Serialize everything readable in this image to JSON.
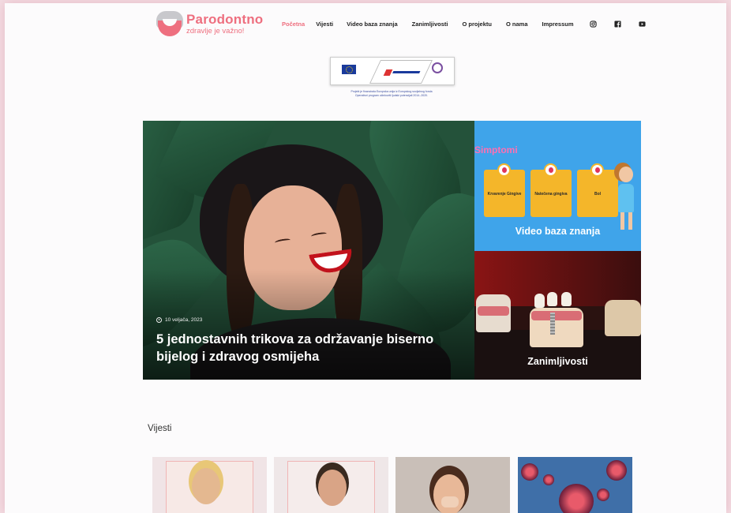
{
  "site": {
    "logo_name": "Parodontno",
    "logo_tagline": "zdravlje je važno!"
  },
  "nav": {
    "items": [
      {
        "label": "Početna",
        "active": true
      },
      {
        "label": "Vijesti"
      },
      {
        "label": "Video baza znanja"
      },
      {
        "label": "Zanimljivosti"
      },
      {
        "label": "O projektu"
      },
      {
        "label": "O nama"
      },
      {
        "label": "Impressum"
      }
    ],
    "social_icons": [
      "instagram-icon",
      "facebook-icon",
      "youtube-icon"
    ]
  },
  "eu_banner": {
    "caption": "Projekt je financirala Europska unija iz Europskog socijalnog fonda\nOperativni program učinkoviti ljudski potencijali 2014.-2020."
  },
  "hero": {
    "date": "10 veljača, 2023",
    "title": "5 jednostavnih trikova za održavanje biserno bijelog i zdravog osmijeha"
  },
  "card_video": {
    "heading": "Simptomi",
    "boxes": [
      "Krvarenje Gingive",
      "Natečena gingiva",
      "Bol"
    ],
    "label": "Video baza znanja"
  },
  "card_zanimljivosti": {
    "label": "Zanimljivosti"
  },
  "news": {
    "section_title": "Vijesti"
  },
  "colors": {
    "brand": "#ee6f7f",
    "video_card": "#3fa4ea",
    "symptom_box": "#f4b62a"
  }
}
